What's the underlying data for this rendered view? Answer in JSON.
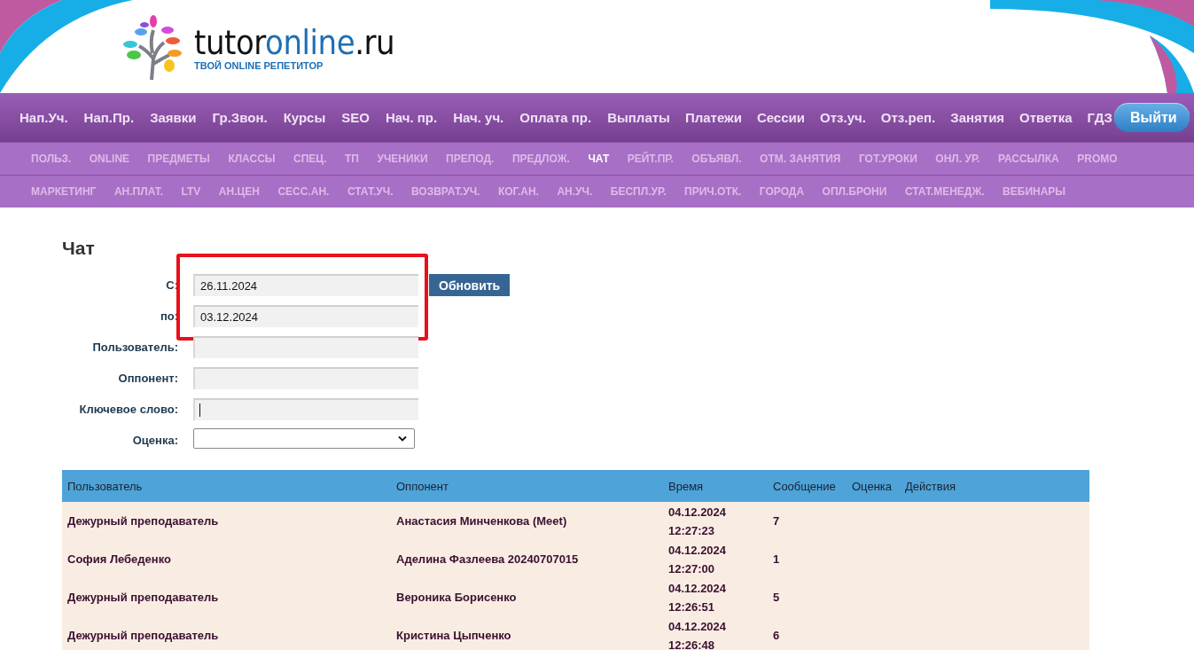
{
  "logo": {
    "parts": [
      {
        "text": "tutor",
        "color": "#111111"
      },
      {
        "text": "online",
        "color": "#1d6fb5"
      },
      {
        "text": ".ru",
        "color": "#111111"
      }
    ],
    "tagline": "ТВОЙ ONLINE РЕПЕТИТОР"
  },
  "main_nav": [
    "Нап.Уч.",
    "Нап.Пр.",
    "Заявки",
    "Гр.Звон.",
    "Курсы",
    "SEO",
    "Нач. пр.",
    "Нач. уч.",
    "Оплата пр.",
    "Выплаты",
    "Платежи",
    "Сессии",
    "Отз.уч.",
    "Отз.реп.",
    "Занятия",
    "Ответка",
    "ГДЗ"
  ],
  "logout_button": "Выйти",
  "sub_nav": [
    [
      {
        "label": "ПОЛЬЗ.",
        "selected": false
      },
      {
        "label": "ONLINE",
        "selected": false
      },
      {
        "label": "ПРЕДМЕТЫ",
        "selected": false
      },
      {
        "label": "КЛАССЫ",
        "selected": false
      },
      {
        "label": "СПЕЦ.",
        "selected": false
      },
      {
        "label": "ТП",
        "selected": false
      },
      {
        "label": "УЧЕНИКИ",
        "selected": false
      },
      {
        "label": "ПРЕПОД.",
        "selected": false
      },
      {
        "label": "ПРЕДЛОЖ.",
        "selected": false
      },
      {
        "label": "ЧАТ",
        "selected": true
      },
      {
        "label": "РЕЙТ.ПР.",
        "selected": false
      },
      {
        "label": "ОБЪЯВЛ.",
        "selected": false
      },
      {
        "label": "ОТМ. ЗАНЯТИЯ",
        "selected": false
      },
      {
        "label": "ГОТ.УРОКИ",
        "selected": false
      },
      {
        "label": "ОНЛ. УР.",
        "selected": false
      },
      {
        "label": "РАССЫЛКА",
        "selected": false
      },
      {
        "label": "PROMO",
        "selected": false
      }
    ],
    [
      {
        "label": "МАРКЕТИНГ",
        "selected": false
      },
      {
        "label": "АН.ПЛАТ.",
        "selected": false
      },
      {
        "label": "LTV",
        "selected": false
      },
      {
        "label": "АН.ЦЕН",
        "selected": false
      },
      {
        "label": "СЕСС.АН.",
        "selected": false
      },
      {
        "label": "СТАТ.УЧ.",
        "selected": false
      },
      {
        "label": "ВОЗВРАТ.УЧ.",
        "selected": false
      },
      {
        "label": "КОГ.АН.",
        "selected": false
      },
      {
        "label": "АН.УЧ.",
        "selected": false
      },
      {
        "label": "БЕСПЛ.УР.",
        "selected": false
      },
      {
        "label": "ПРИЧ.ОТК.",
        "selected": false
      },
      {
        "label": "ГОРОДА",
        "selected": false
      },
      {
        "label": "ОПЛ.БРОНИ",
        "selected": false
      },
      {
        "label": "СТАТ.МЕНЕДЖ.",
        "selected": false
      },
      {
        "label": "ВЕБИНАРЫ",
        "selected": false
      }
    ]
  ],
  "page_title": "Чат",
  "filters": [
    {
      "label": "С:",
      "kind": "text",
      "value": "26.11.2024",
      "highlighted": true
    },
    {
      "label": "по:",
      "kind": "text",
      "value": "03.12.2024",
      "highlighted": true
    },
    {
      "label": "Пользователь:",
      "kind": "text"
    },
    {
      "label": "Оппонент:",
      "kind": "text"
    },
    {
      "label": "Ключевое слово:",
      "kind": "text",
      "focused": true
    },
    {
      "label": "Оценка:",
      "kind": "select"
    }
  ],
  "refresh_button": "Обновить",
  "table": {
    "columns": [
      "Пользователь",
      "Оппонент",
      "Время",
      "Сообщение",
      "Оценка",
      "Действия"
    ],
    "rows": [
      [
        "Дежурный преподаватель",
        "Анастасия Минченкова (Meet)",
        "04.12.2024 12:27:23",
        "7"
      ],
      [
        "София Лебеденко",
        "Аделина Фазлеева 20240707015",
        "04.12.2024 12:27:00",
        "1"
      ],
      [
        "Дежурный преподаватель",
        "Вероника Борисенко",
        "04.12.2024 12:26:51",
        "5"
      ],
      [
        "Дежурный преподаватель",
        "Кристина Цыпченко",
        "04.12.2024 12:26:48",
        "6"
      ]
    ]
  }
}
